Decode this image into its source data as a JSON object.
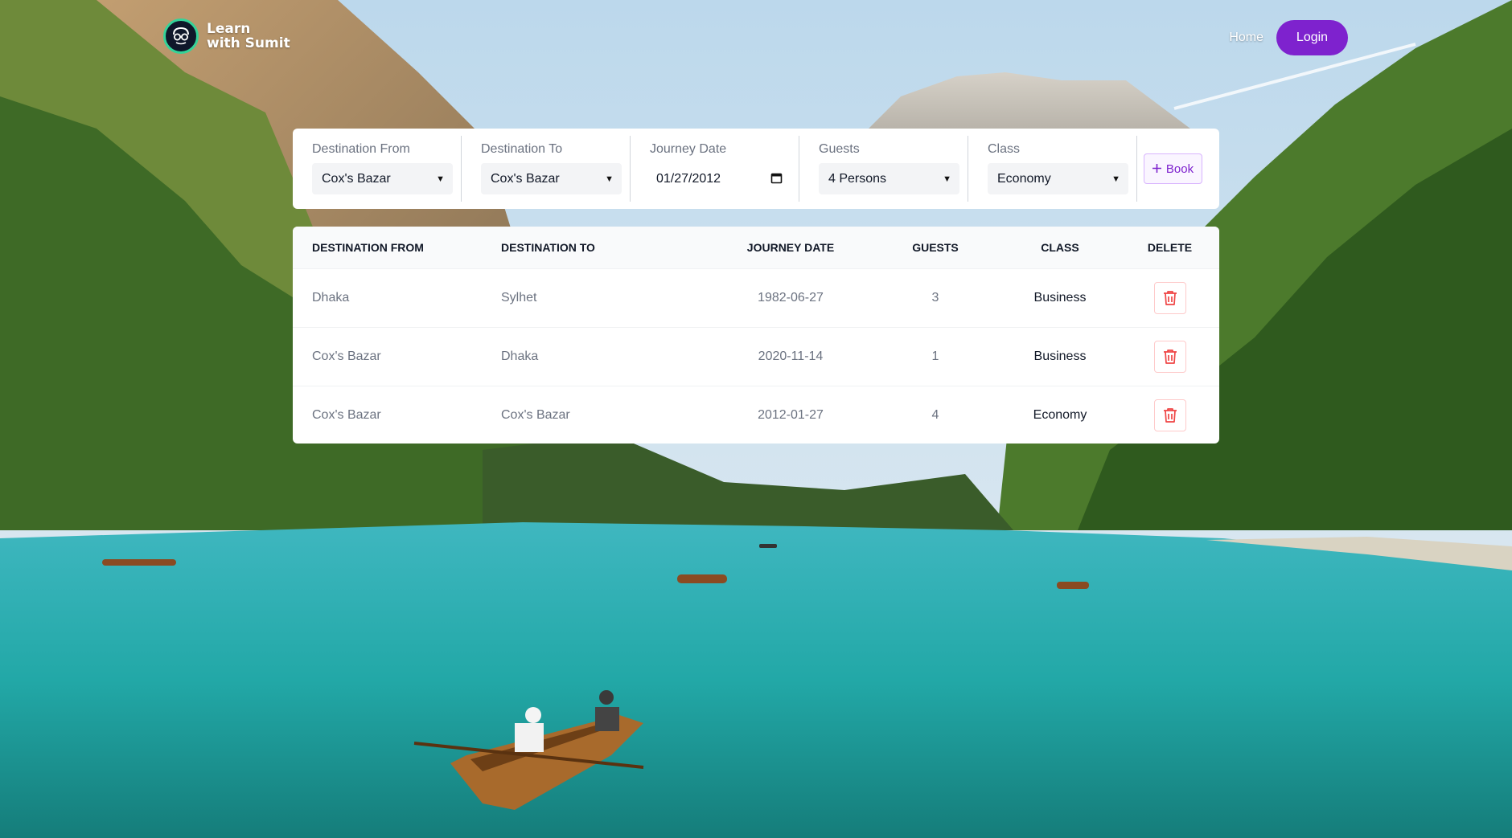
{
  "header": {
    "logo_line1": "Learn",
    "logo_line2": "with Sumit",
    "nav_home": "Home",
    "nav_login": "Login"
  },
  "booking_form": {
    "destination_from": {
      "label": "Destination From",
      "value": "Cox's Bazar"
    },
    "destination_to": {
      "label": "Destination To",
      "value": "Cox's Bazar"
    },
    "journey_date": {
      "label": "Journey Date",
      "value": "01/27/2012"
    },
    "guests": {
      "label": "Guests",
      "value": "4 Persons"
    },
    "class": {
      "label": "Class",
      "value": "Economy"
    },
    "book_label": "Book"
  },
  "table": {
    "headers": [
      "Destination From",
      "Destination To",
      "Journey Date",
      "Guests",
      "Class",
      "Delete"
    ],
    "rows": [
      {
        "from": "Dhaka",
        "to": "Sylhet",
        "date": "1982-06-27",
        "guests": "3",
        "class": "Business"
      },
      {
        "from": "Cox's Bazar",
        "to": "Dhaka",
        "date": "2020-11-14",
        "guests": "1",
        "class": "Business"
      },
      {
        "from": "Cox's Bazar",
        "to": "Cox's Bazar",
        "date": "2012-01-27",
        "guests": "4",
        "class": "Economy"
      }
    ]
  },
  "colors": {
    "accent": "#7e22ce",
    "delete": "#ef4444",
    "lake": "#2bb3b1"
  },
  "icons": {
    "logo": "glasses-face-icon",
    "book": "plus-icon",
    "delete": "trash-icon",
    "select": "chevron-down-icon",
    "date": "calendar-icon"
  }
}
